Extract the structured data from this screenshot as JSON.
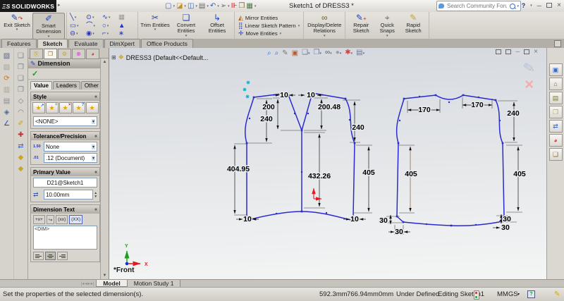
{
  "window": {
    "brand_mark": "ΞS",
    "brand": "SOLIDWORKS",
    "title": "Sketch1 of DRESS3 *",
    "search_placeholder": "Search Community Forum",
    "help": "?"
  },
  "ribbon": {
    "exit_sketch": "Exit Sketch",
    "smart_dimension": "Smart Dimension",
    "trim": "Trim Entities",
    "convert": "Convert Entities",
    "offset": "Offset Entities",
    "mirror": "Mirror Entities",
    "linear_pattern": "Linear Sketch Pattern",
    "move": "Move Entities",
    "display_delete": "Display/Delete Relations",
    "repair": "Repair Sketch",
    "quick_snaps": "Quick Snaps",
    "rapid": "Rapid Sketch"
  },
  "tabs": {
    "items": [
      "Features",
      "Sketch",
      "Evaluate",
      "DimXpert",
      "Office Products"
    ],
    "active": "Sketch"
  },
  "pm": {
    "title": "Dimension",
    "help": "?",
    "tab_value": "Value",
    "tab_leaders": "Leaders",
    "tab_other": "Other",
    "style": {
      "header": "Style",
      "value": "<NONE>"
    },
    "tolerance": {
      "header": "Tolerance/Precision",
      "icon1": "1.50",
      "icon2": ".01",
      "value1": "None",
      "value2": ".12 (Document)"
    },
    "primary": {
      "header": "Primary Value",
      "name": "D21@Sketch1",
      "value": "10.00mm"
    },
    "dim_text": {
      "header": "Dimension Text",
      "btn1": "+x+",
      "btn3": "(xx)",
      "btn4": "(XX)",
      "content": "<DIM>"
    }
  },
  "viewport": {
    "tree_item": "DRESS3  (Default<<Default...",
    "view_label": "*Front",
    "axis_x": "X",
    "axis_y": "Y"
  },
  "sketch": {
    "front": {
      "shoulder_l": "10",
      "shoulder_r": "10",
      "neck_l": "200",
      "neck_r": "200.48",
      "armhole_l": "240",
      "armhole_r": "240",
      "side_l": "404.95",
      "center": "432.26",
      "side_r": "405",
      "hem_l": "10",
      "hem_r": "10"
    },
    "back": {
      "shoulder_l": "170",
      "shoulder_r": "170",
      "armhole_r": "240",
      "side_l": "405",
      "side_r": "405",
      "hem_l_v": "30",
      "hem_l_h": "30",
      "hem_r_v": "30",
      "hem_r_h": "30"
    }
  },
  "bottom_tabs": {
    "model": "Model",
    "motion": "Motion Study 1"
  },
  "status": {
    "message": "Set the properties of the selected dimension(s).",
    "x": "592.3mm",
    "y": "766.94mm",
    "z": "0mm",
    "state": "Under Defined",
    "editing": "Editing Sketch1",
    "units": "MMGS"
  }
}
